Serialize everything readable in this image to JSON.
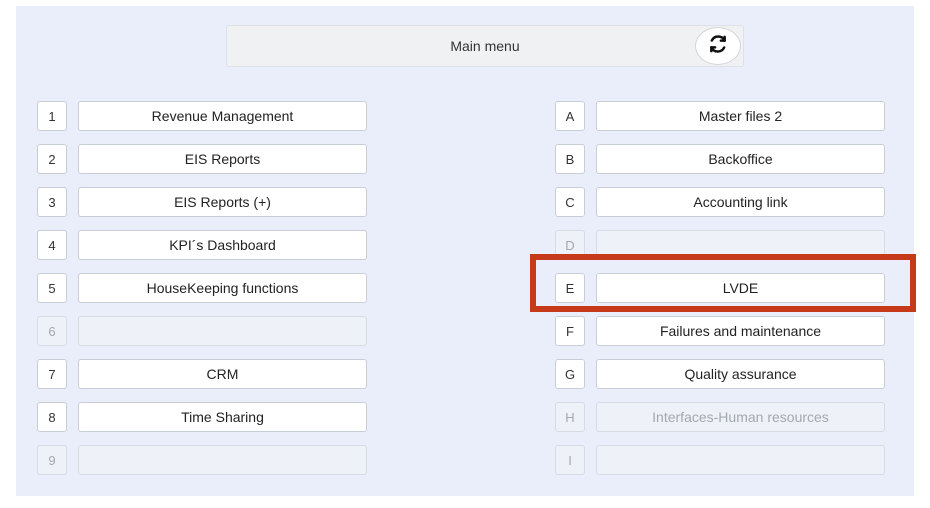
{
  "header": {
    "title": "Main menu",
    "refresh_icon": "refresh-icon"
  },
  "left_items": [
    {
      "key": "1",
      "label": "Revenue Management",
      "enabled": true
    },
    {
      "key": "2",
      "label": "EIS Reports",
      "enabled": true
    },
    {
      "key": "3",
      "label": "EIS Reports (+)",
      "enabled": true
    },
    {
      "key": "4",
      "label": "KPI´s Dashboard",
      "enabled": true
    },
    {
      "key": "5",
      "label": "HouseKeeping functions",
      "enabled": true
    },
    {
      "key": "6",
      "label": "",
      "enabled": false
    },
    {
      "key": "7",
      "label": "CRM",
      "enabled": true
    },
    {
      "key": "8",
      "label": "Time Sharing",
      "enabled": true
    },
    {
      "key": "9",
      "label": "",
      "enabled": false
    }
  ],
  "right_items": [
    {
      "key": "A",
      "label": "Master files 2",
      "enabled": true
    },
    {
      "key": "B",
      "label": "Backoffice",
      "enabled": true
    },
    {
      "key": "C",
      "label": "Accounting link",
      "enabled": true
    },
    {
      "key": "D",
      "label": "",
      "enabled": false
    },
    {
      "key": "E",
      "label": "LVDE",
      "enabled": true
    },
    {
      "key": "F",
      "label": "Failures and maintenance",
      "enabled": true
    },
    {
      "key": "G",
      "label": "Quality assurance",
      "enabled": true
    },
    {
      "key": "H",
      "label": "Interfaces-Human resources",
      "enabled": false
    },
    {
      "key": "I",
      "label": "",
      "enabled": false
    }
  ],
  "highlight": {
    "target": "E",
    "color": "#c63a1a"
  }
}
